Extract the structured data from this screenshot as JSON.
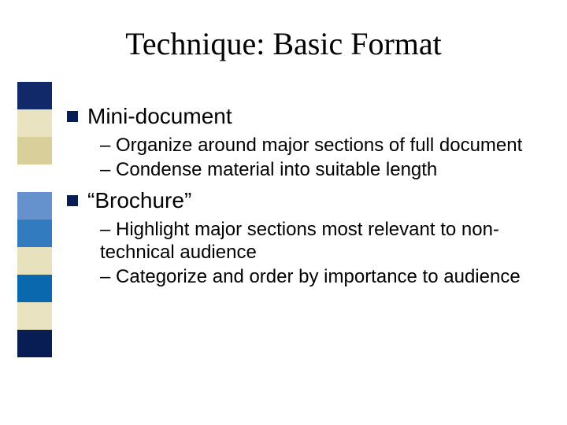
{
  "title": "Technique: Basic Format",
  "sections": [
    {
      "heading": "Mini-document",
      "subs": [
        "– Organize around major sections of full document",
        "– Condense material into suitable length"
      ]
    },
    {
      "heading": "“Brochure”",
      "subs": [
        "– Highlight major sections most relevant to non-technical audience",
        "– Categorize and order by importance to audience"
      ]
    }
  ]
}
